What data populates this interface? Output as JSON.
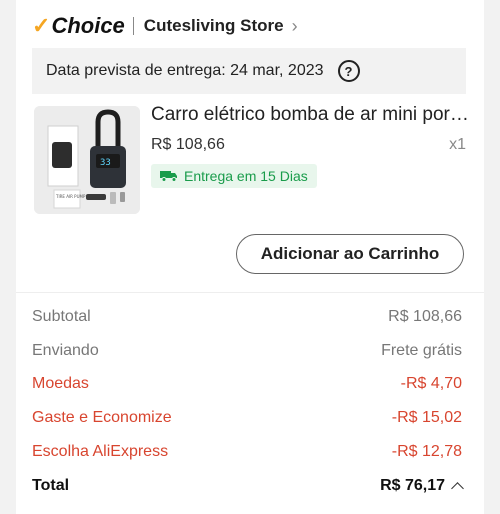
{
  "store": {
    "brand": "Choice",
    "name": "Cutesliving Store"
  },
  "delivery": {
    "text": "Data prevista de entrega: 24 mar, 2023"
  },
  "product": {
    "title": "Carro elétrico bomba de ar mini portátil",
    "price": "R$ 108,66",
    "qty": "x1",
    "shipping": "Entrega em 15 Dias",
    "image_label": "TIRE AIR PUMP"
  },
  "cart_button": "Adicionar ao Carrinho",
  "summary": {
    "subtotal_label": "Subtotal",
    "subtotal_value": "R$ 108,66",
    "shipping_label": "Enviando",
    "shipping_value": "Frete grátis",
    "coins_label": "Moedas",
    "coins_value": "-R$ 4,70",
    "save_label": "Gaste e Economize",
    "save_value": "-R$ 15,02",
    "choice_label": "Escolha AliExpress",
    "choice_value": "-R$ 12,78",
    "total_label": "Total",
    "total_value": "R$ 76,17"
  },
  "colors": {
    "accent_red": "#d8452f",
    "green": "#1a9c4b",
    "choice_orange": "#f5a623"
  }
}
